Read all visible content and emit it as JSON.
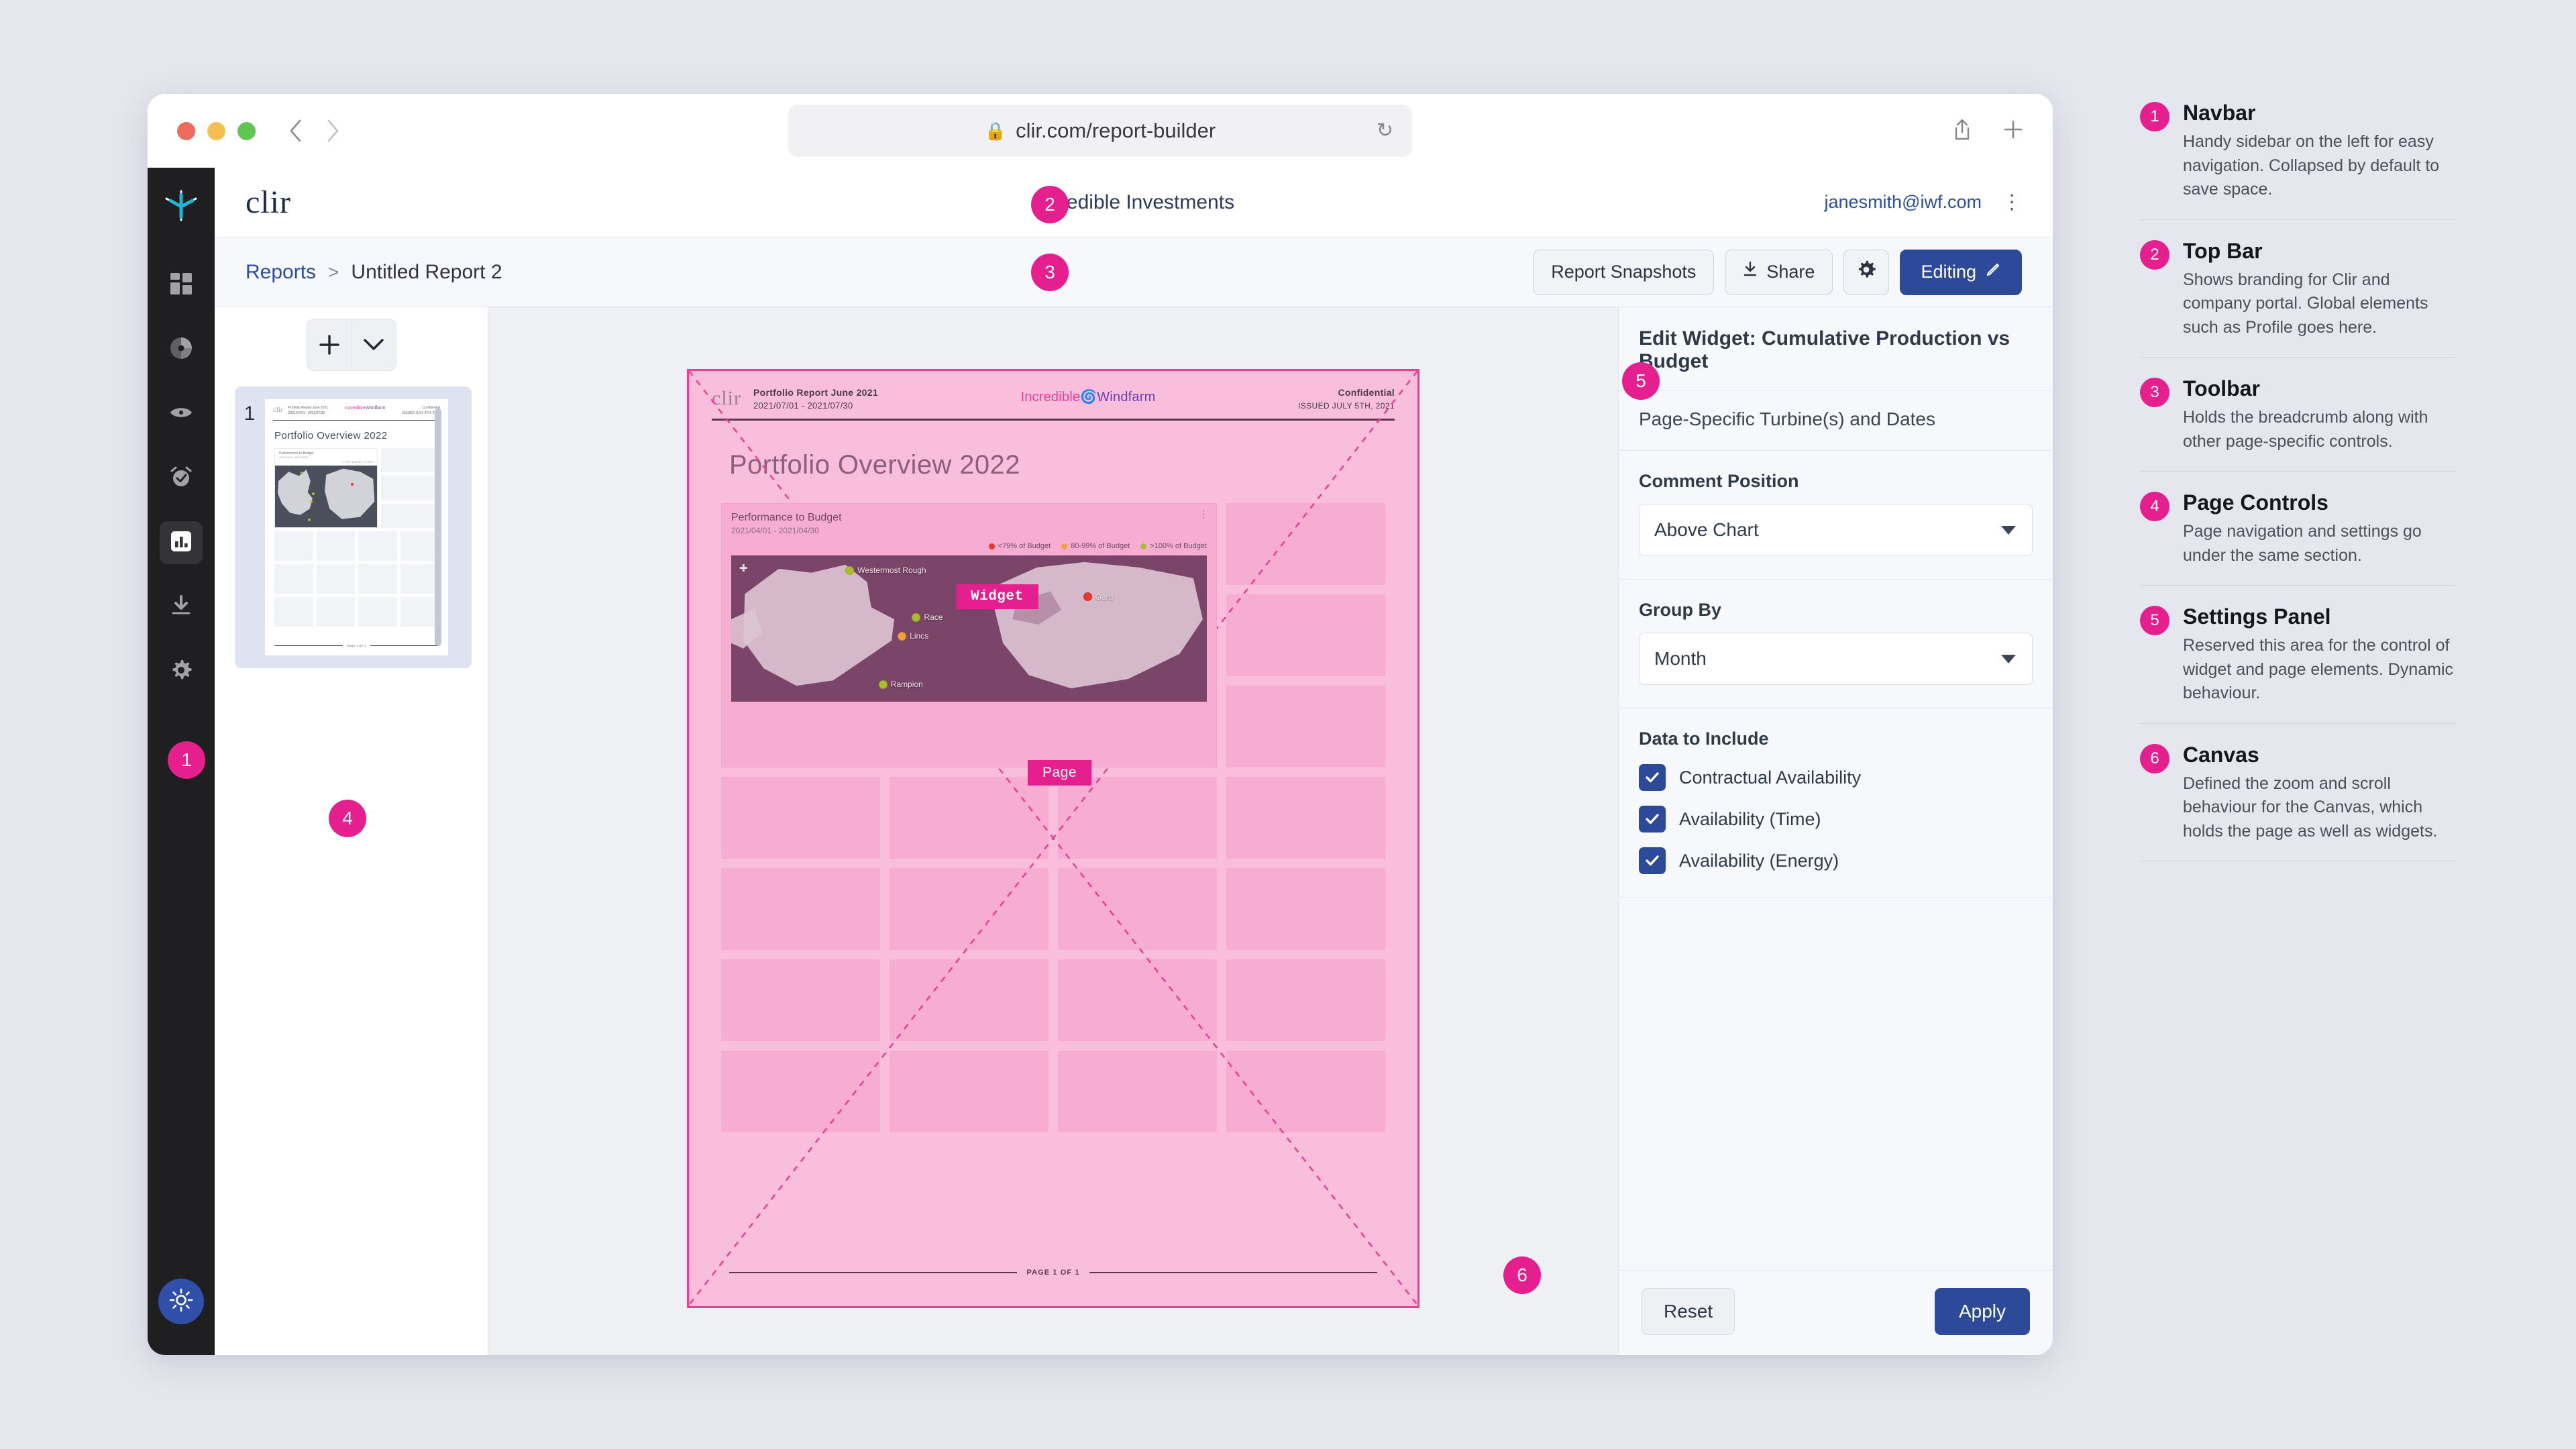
{
  "browser": {
    "url": "clir.com/report-builder",
    "lock_icon": "lock-icon",
    "reload_icon": "reload-icon",
    "back_icon": "back-chevron-icon",
    "forward_icon": "forward-chevron-icon",
    "share_icon": "share-icon",
    "newtab_icon": "plus-icon"
  },
  "topbar": {
    "brand": "clir",
    "company": "Incredible Investments",
    "email": "janesmith@iwf.com",
    "menu_icon": "kebab-menu-icon"
  },
  "toolbar": {
    "breadcrumb_root": "Reports",
    "breadcrumb_sep": ">",
    "breadcrumb_current": "Untitled Report 2",
    "snapshots_label": "Report Snapshots",
    "share_label": "Share",
    "share_icon": "download-icon",
    "settings_icon": "gear-icon",
    "editing_label": "Editing",
    "editing_icon": "pencil-icon"
  },
  "sidebar": {
    "logo_icon": "clir-star-logo-icon",
    "items": [
      {
        "icon": "dashboard-grid-icon",
        "active": false
      },
      {
        "icon": "pie-chart-icon",
        "active": false
      },
      {
        "icon": "eye-icon",
        "active": false
      },
      {
        "icon": "alarm-clock-icon",
        "active": false
      },
      {
        "icon": "bar-chart-icon",
        "active": true
      },
      {
        "icon": "download-icon",
        "active": false
      },
      {
        "icon": "gear-icon",
        "active": false
      }
    ],
    "theme_toggle_icon": "sun-icon"
  },
  "pages_panel": {
    "add_icon": "plus-icon",
    "expand_icon": "chevron-down-icon",
    "page_number": "1"
  },
  "canvas": {
    "overlay_widget_label": "Widget",
    "overlay_page_label": "Page",
    "report_header": {
      "clir": "clir",
      "title": "Portfolio  Report June 2021",
      "date_range": "2021/07/01 - 2021/07/30",
      "logo_first": "Incredible",
      "logo_second": "Windfarm",
      "logo_mark": "windmill-swirl-icon",
      "confidential": "Confidential",
      "issued": "ISSUED JULY 5TH, 2021"
    },
    "page_title": "Portfolio Overview 2022",
    "widget": {
      "title": "Performance to Budget",
      "date_range": "2021/04/01 - 2021/04/30",
      "kebab_icon": "kebab-menu-icon",
      "legend": [
        {
          "label": "<79% of Budget",
          "color": "#e8382e"
        },
        {
          "label": "80-99% of Budget",
          "color": "#f0a13a"
        },
        {
          "label": ">100% of Budget",
          "color": "#a8bf2b"
        }
      ],
      "map_markers": [
        {
          "label": "Westermost Rough",
          "color": "#a8bf2b",
          "x": 27,
          "y": 11
        },
        {
          "label": "Race",
          "color": "#a8bf2b",
          "x": 41,
          "y": 42
        },
        {
          "label": "Lincs",
          "color": "#f0a13a",
          "x": 38,
          "y": 52
        },
        {
          "label": "Gard",
          "color": "#e8382e",
          "x": 77,
          "y": 28
        },
        {
          "label": "Rampion",
          "color": "#a8bf2b",
          "x": 34,
          "y": 88
        }
      ],
      "compass_icon": "compass-icon"
    },
    "footer": "PAGE 1 OF 1"
  },
  "settings": {
    "heading": "Edit Widget: Cumulative Production vs Budget",
    "subheading": "Page-Specific Turbine(s) and Dates",
    "comment_position": {
      "label": "Comment Position",
      "value": "Above Chart",
      "caret_icon": "chevron-down-icon"
    },
    "group_by": {
      "label": "Group By",
      "value": "Month",
      "caret_icon": "chevron-down-icon"
    },
    "data_to_include": {
      "label": "Data to Include",
      "options": [
        {
          "label": "Contractual Availability",
          "checked": true
        },
        {
          "label": "Availability (Time)",
          "checked": true
        },
        {
          "label": "Availability (Energy)",
          "checked": true
        }
      ]
    },
    "reset_label": "Reset",
    "apply_label": "Apply"
  },
  "annotations": {
    "accent_color": "#e51f8e",
    "badges": [
      "1",
      "2",
      "3",
      "4",
      "5",
      "6"
    ],
    "legend": [
      {
        "num": "1",
        "title": "Navbar",
        "desc": "Handy sidebar on the left for easy navigation. Collapsed by default to save space."
      },
      {
        "num": "2",
        "title": "Top Bar",
        "desc": "Shows branding for Clir and company portal. Global elements such as Profile goes here."
      },
      {
        "num": "3",
        "title": "Toolbar",
        "desc": "Holds the breadcrumb along with other page-specific controls."
      },
      {
        "num": "4",
        "title": "Page Controls",
        "desc": "Page navigation and settings go under the same section."
      },
      {
        "num": "5",
        "title": "Settings Panel",
        "desc": "Reserved this area for the control of widget and page elements. Dynamic behaviour."
      },
      {
        "num": "6",
        "title": "Canvas",
        "desc": "Defined the zoom and scroll behaviour for the Canvas, which holds the page as well as widgets."
      }
    ]
  }
}
